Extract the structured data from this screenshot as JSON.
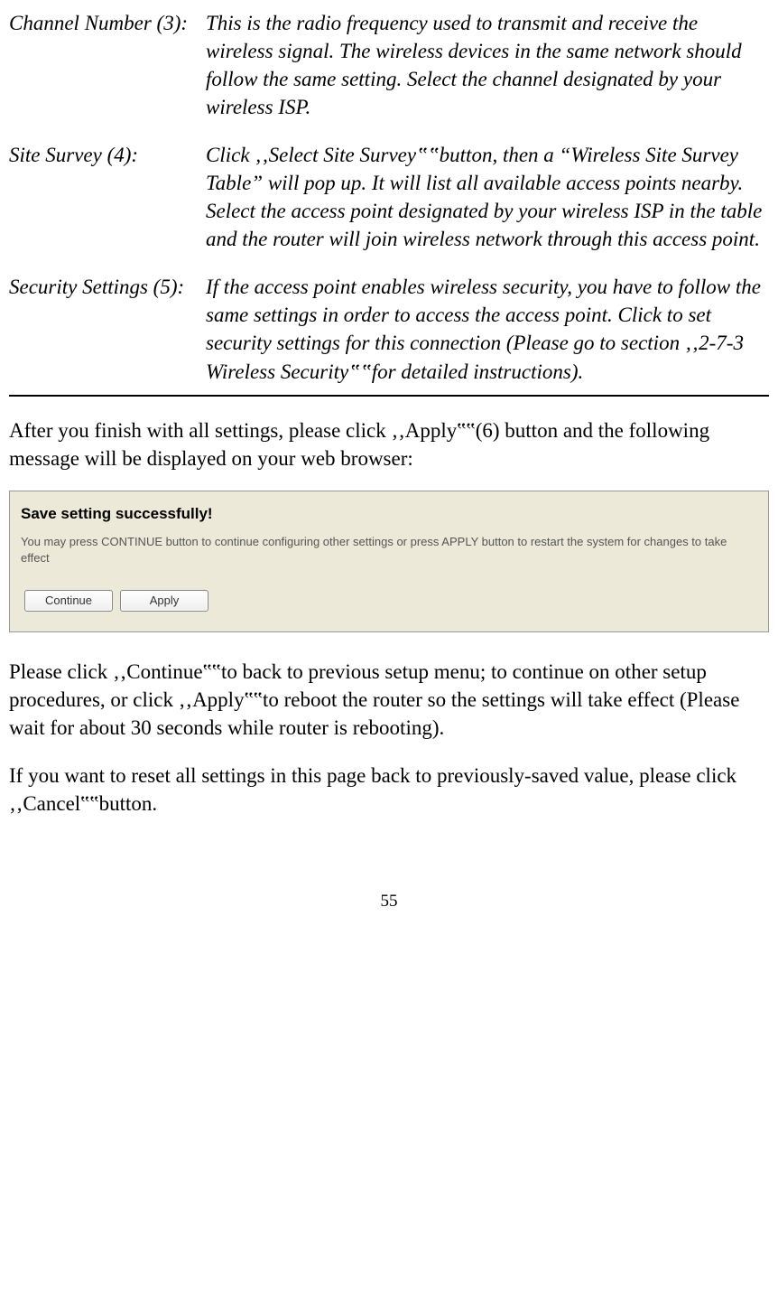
{
  "definitions": [
    {
      "term": "Channel Number (3):",
      "desc": "This is the radio frequency used to transmit and receive the wireless signal. The wireless devices in the same network should follow the same setting. Select the channel designated by your wireless ISP."
    },
    {
      "term": "Site Survey (4):",
      "desc": "Click ‚‚Select Site Survey‟‟button, then a “Wireless Site Survey Table” will pop up. It will list all available access points nearby. Select the access point designated by your wireless ISP in the table and the router will join wireless network through this access point."
    },
    {
      "term": "Security Settings (5):",
      "desc": "If the access point enables wireless security, you have to follow the same settings in order to access the access point. Click to set security settings for this connection   (Please go to section ‚‚2-7-3 Wireless Security‟‟for detailed instructions)."
    }
  ],
  "para_apply": "After you finish with all settings, please click ‚‚Apply‟‟(6) button and the following message will be displayed on your web browser:",
  "screenshot": {
    "title": "Save setting successfully!",
    "desc": "You may press CONTINUE button to continue configuring other settings or press APPLY button to restart the system for changes to take effect",
    "continue_label": "Continue",
    "apply_label": "Apply"
  },
  "para_continue": "Please click ‚‚Continue‟‟to back to previous setup menu; to continue on other setup procedures, or click ‚‚Apply‟‟to reboot the router so the settings will take effect (Please wait for about 30 seconds while router is rebooting).",
  "para_cancel": "If you want to reset all settings in this page back to previously-saved value, please click ‚‚Cancel‟‟button.",
  "page_number": "55"
}
